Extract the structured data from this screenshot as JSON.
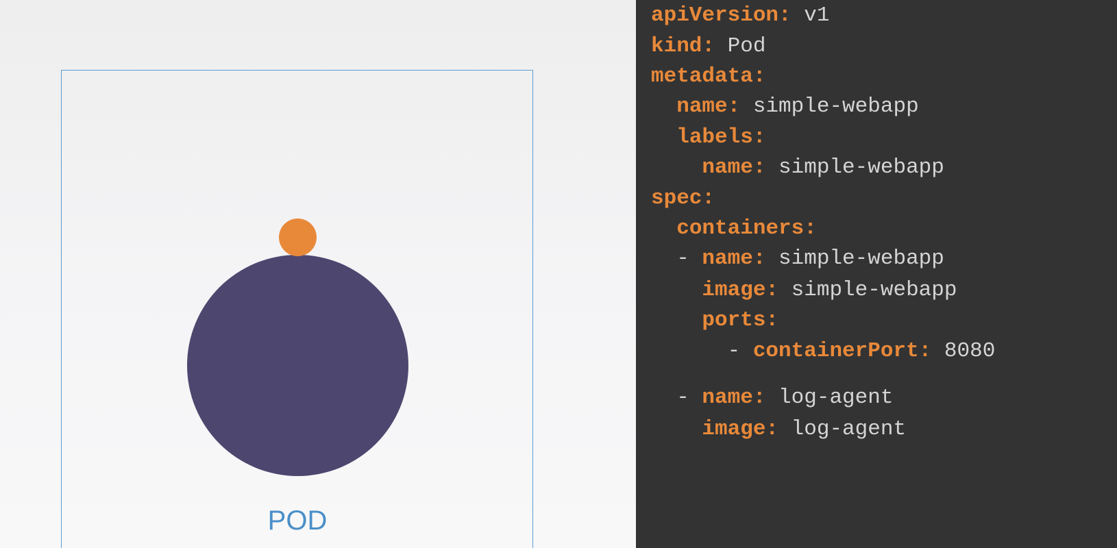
{
  "diagram": {
    "pod_label": "POD"
  },
  "colors": {
    "pod_border": "#5b9bd5",
    "container": "#4d476f",
    "sidecar": "#e8893a",
    "key": "#e8893a",
    "value": "#d4d4d4",
    "code_bg": "#333333"
  },
  "yaml": {
    "lines": [
      {
        "prefix": "",
        "key": "apiVersion:",
        "value": " v1"
      },
      {
        "prefix": "",
        "key": "kind:",
        "value": " Pod"
      },
      {
        "prefix": "",
        "key": "metadata:",
        "value": ""
      },
      {
        "prefix": "  ",
        "key": "name:",
        "value": " simple-webapp"
      },
      {
        "prefix": "  ",
        "key": "labels:",
        "value": ""
      },
      {
        "prefix": "    ",
        "key": "name:",
        "value": " simple-webapp"
      },
      {
        "prefix": "",
        "key": "spec:",
        "value": ""
      },
      {
        "prefix": "  ",
        "key": "containers:",
        "value": ""
      },
      {
        "prefix": "  - ",
        "key": "name:",
        "value": " simple-webapp"
      },
      {
        "prefix": "    ",
        "key": "image:",
        "value": " simple-webapp"
      },
      {
        "prefix": "    ",
        "key": "ports:",
        "value": ""
      },
      {
        "prefix": "      - ",
        "key": "containerPort:",
        "value": " 8080"
      },
      {
        "prefix": "  - ",
        "key": "name:",
        "value": " log-agent"
      },
      {
        "prefix": "    ",
        "key": "image:",
        "value": " log-agent"
      }
    ]
  }
}
